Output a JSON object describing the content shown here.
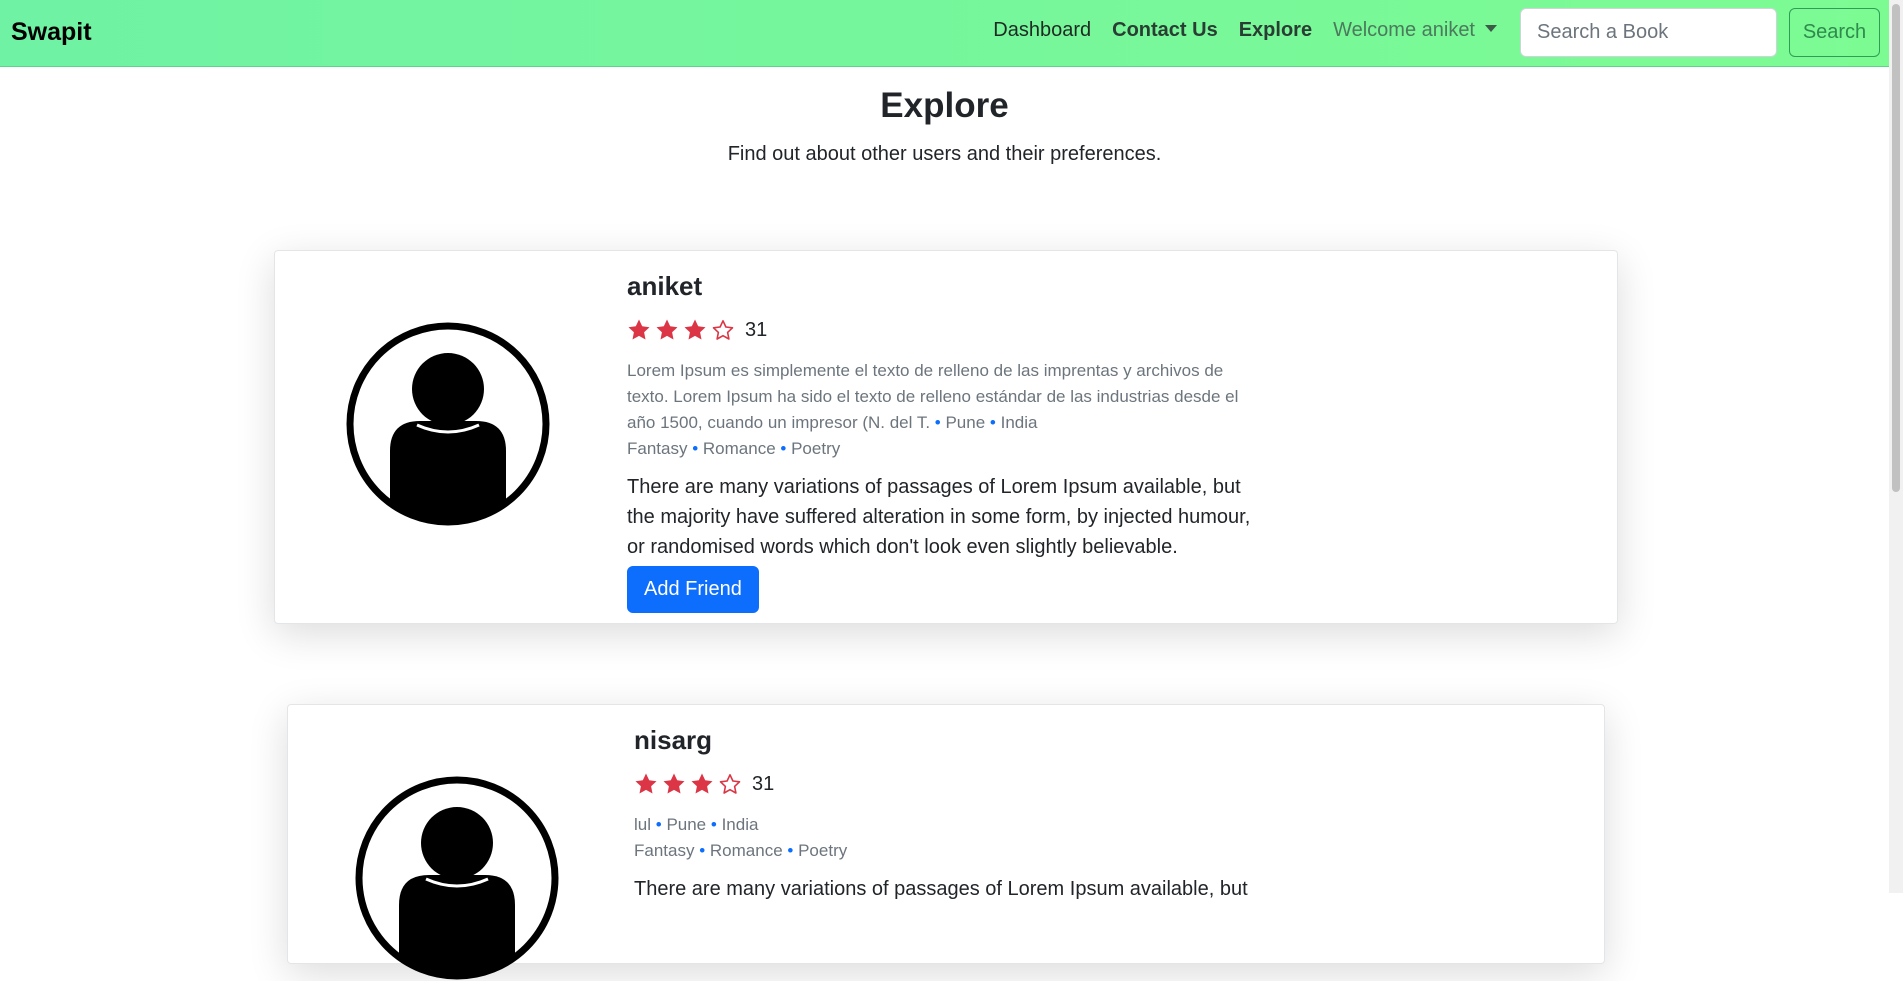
{
  "navbar": {
    "brand": "Swapit",
    "links": {
      "dashboard": "Dashboard",
      "contact": "Contact Us",
      "explore": "Explore",
      "welcome": "Welcome aniket"
    },
    "search_placeholder": "Search a Book",
    "search_button": "Search"
  },
  "header": {
    "title": "Explore",
    "subtitle": "Find out about other users and their preferences."
  },
  "users": [
    {
      "name": "aniket",
      "rating": 3,
      "rating_max": 5,
      "rating_count": "31",
      "bio": "Lorem Ipsum es simplemente el texto de relleno de las imprentas y archivos de texto. Lorem Ipsum ha sido el texto de relleno estándar de las industrias desde el año 1500, cuando un impresor (N. del T.",
      "city": "Pune",
      "country": "India",
      "genres": [
        "Fantasy",
        "Romance",
        "Poetry"
      ],
      "description": "There are many variations of passages of Lorem Ipsum available, but the majority have suffered alteration in some form, by injected humour, or randomised words which don't look even slightly believable.",
      "button": "Add Friend"
    },
    {
      "name": "nisarg",
      "rating": 3,
      "rating_max": 5,
      "rating_count": "31",
      "bio": "lul",
      "city": "Pune",
      "country": "India",
      "genres": [
        "Fantasy",
        "Romance",
        "Poetry"
      ],
      "description": "There are many variations of passages of Lorem Ipsum available, but"
    }
  ],
  "colors": {
    "navbar_gradient_start": "#6ff2a4",
    "navbar_gradient_end": "#7dfb93",
    "star": "#dc3545",
    "primary": "#0d6efd",
    "separator_dot": "#0d6efd"
  },
  "icons": {
    "avatar": "user-circle-icon",
    "star_filled": "star-filled-icon",
    "star_empty": "star-outline-icon",
    "dropdown": "caret-down-icon"
  }
}
